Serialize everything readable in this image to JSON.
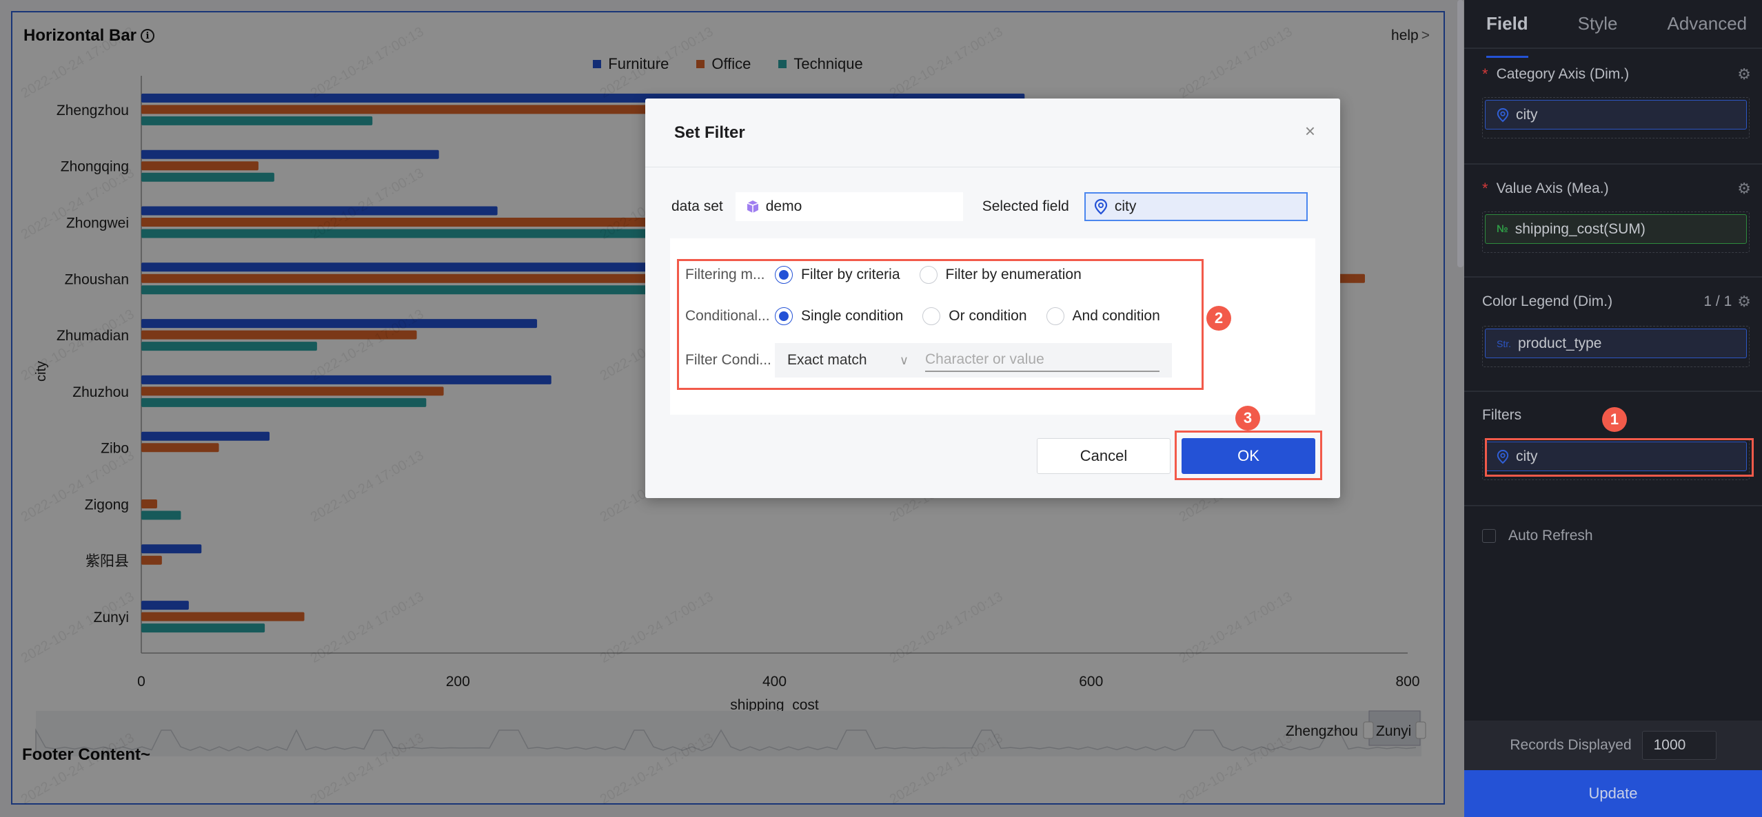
{
  "chart": {
    "title": "Horizontal Bar",
    "help_label": "help",
    "footer": "Footer Content~",
    "watermark": "2022-10-24 17:00:13",
    "minimap": {
      "start_label": "Zhengzhou",
      "end_label": "Zunyi"
    }
  },
  "chart_data": {
    "type": "bar",
    "orientation": "horizontal",
    "title": "Horizontal Bar",
    "xlabel": "shipping_cost",
    "ylabel": "city",
    "xlim": [
      0,
      800
    ],
    "xticks": [
      0,
      200,
      400,
      600,
      800
    ],
    "grid": false,
    "legend_position": "top-center",
    "categories": [
      "Zhengzhou",
      "Zhongqing",
      "Zhongwei",
      "Zhoushan",
      "Zhumadian",
      "Zhuzhou",
      "Zibo",
      "Zigong",
      "紫阳县",
      "Zunyi"
    ],
    "series": [
      {
        "name": "Furniture",
        "color": "#2452d6",
        "values": [
          558,
          188,
          225,
          600,
          250,
          259,
          81,
          0,
          38,
          30
        ]
      },
      {
        "name": "Office",
        "color": "#e0672a",
        "values": [
          520,
          74,
          480,
          773,
          174,
          191,
          49,
          10,
          13,
          103
        ]
      },
      {
        "name": "Technique",
        "color": "#2aa5a5",
        "values": [
          146,
          84,
          430,
          520,
          111,
          180,
          0,
          25,
          0,
          78
        ]
      }
    ]
  },
  "dialog": {
    "title": "Set Filter",
    "close_label": "×",
    "dataset_label": "data set",
    "dataset_value": "demo",
    "selected_field_label": "Selected field",
    "selected_field_value": "city",
    "filtering_mode": {
      "label": "Filtering m...",
      "options": [
        "Filter by criteria",
        "Filter by enumeration"
      ],
      "selected": "Filter by criteria"
    },
    "conditional": {
      "label": "Conditional...",
      "options": [
        "Single condition",
        "Or condition",
        "And condition"
      ],
      "selected": "Single condition"
    },
    "filter_condition": {
      "label": "Filter Condi...",
      "match_type": "Exact match",
      "value_placeholder": "Character or value",
      "value": ""
    },
    "cancel_label": "Cancel",
    "ok_label": "OK"
  },
  "annotations": {
    "step1": "1",
    "step2": "2",
    "step3": "3",
    "highlight_color": "#f25a4a"
  },
  "panel": {
    "tabs": [
      {
        "label": "Field",
        "active": true
      },
      {
        "label": "Style",
        "active": false
      },
      {
        "label": "Advanced",
        "active": false
      }
    ],
    "category_axis": {
      "label": "Category Axis (Dim.)",
      "required": "*",
      "field": "city"
    },
    "value_axis": {
      "label": "Value Axis (Mea.)",
      "required": "*",
      "field": "shipping_cost(SUM)",
      "type_tag": "№"
    },
    "color_legend": {
      "label": "Color Legend (Dim.)",
      "count": "1 / 1",
      "field": "product_type",
      "type_tag": "Str."
    },
    "filters": {
      "label": "Filters",
      "field": "city"
    },
    "auto_refresh": {
      "label": "Auto Refresh",
      "checked": false
    },
    "records_displayed": {
      "label": "Records Displayed",
      "value": "1000"
    },
    "update_label": "Update"
  },
  "colors": {
    "accent": "#2452d6",
    "furniture": "#2452d6",
    "office": "#e0672a",
    "technique": "#2aa5a5"
  }
}
